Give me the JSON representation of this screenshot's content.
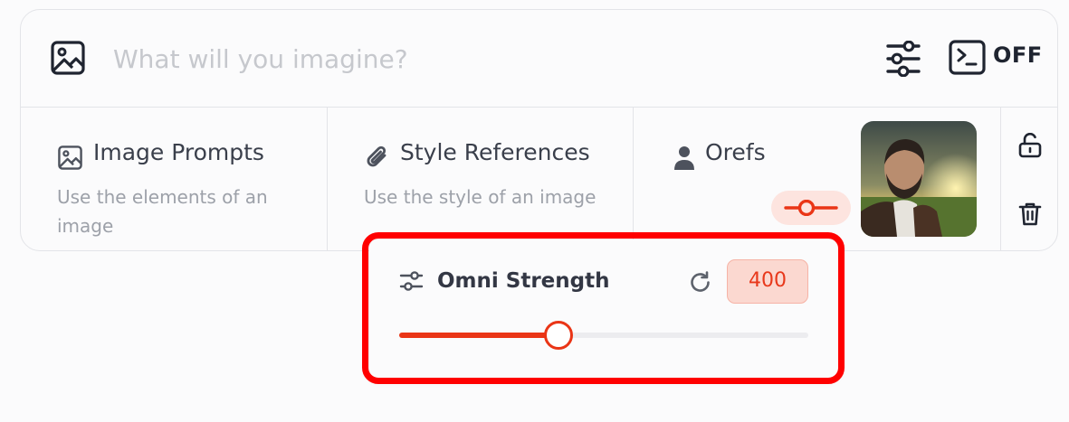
{
  "prompt": {
    "placeholder": "What will you imagine?",
    "value": "",
    "raw_mode_label": "OFF"
  },
  "references": [
    {
      "title": "Image Prompts",
      "description": "Use the elements of an image",
      "icon": "image-icon"
    },
    {
      "title": "Style References",
      "description": "Use the style of an image",
      "icon": "paperclip-icon"
    },
    {
      "title": "Orefs",
      "description": "",
      "icon": "user-icon"
    }
  ],
  "omni": {
    "title": "Omni Strength",
    "value": "400",
    "slider_fraction": 0.39
  },
  "colors": {
    "accent": "#ea3516",
    "highlight": "#ff0000",
    "value_bg": "#fbd8d0"
  },
  "icons": [
    "image-icon",
    "sliders-icon",
    "terminal-icon",
    "paperclip-icon",
    "user-icon",
    "unlock-icon",
    "trash-icon",
    "reset-icon"
  ]
}
